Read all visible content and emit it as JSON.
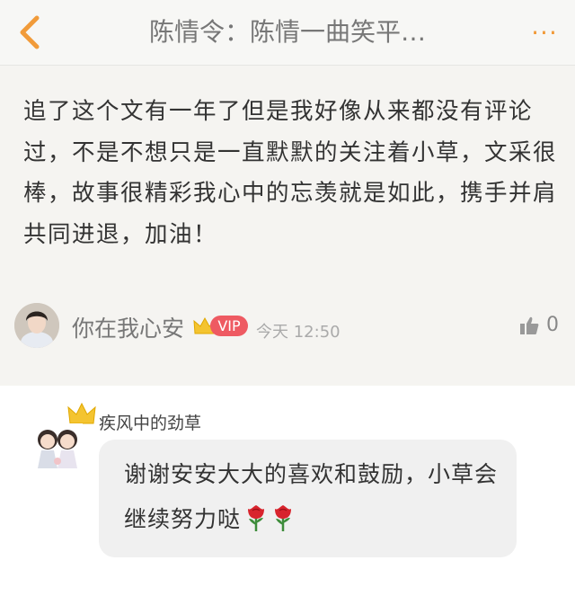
{
  "header": {
    "back_icon": "chevron-left-icon",
    "title": "陈情令：陈情一曲笑平…",
    "more_icon": "more-dots-icon",
    "more_glyph": "···",
    "accent_color": "#f19b3a"
  },
  "post": {
    "text": "追了这个文有一年了但是我好像从来都没有评论过，不是不想只是一直默默的关注着小草，文采很棒，故事很精彩我心中的忘羡就是如此，携手并肩共同进退，加油！",
    "author": {
      "name": "你在我心安",
      "badge": "VIP",
      "badge_color": "#ee5a62"
    },
    "time": "今天 12:50",
    "likes": "0"
  },
  "reply": {
    "author": "疾风中的劲草",
    "text": "谢谢安安大大的喜欢和鼓励，小草会继续努力哒",
    "emoji_icons": [
      "rose-icon",
      "rose-icon"
    ]
  }
}
